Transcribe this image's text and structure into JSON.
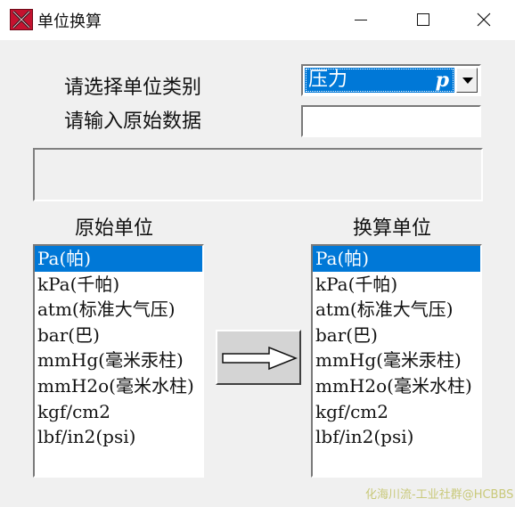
{
  "window": {
    "title": "单位换算",
    "controls": {
      "minimize": "minimize-icon",
      "maximize": "maximize-icon",
      "close": "close-icon"
    }
  },
  "form": {
    "category_label": "请选择单位类别",
    "input_label": "请输入原始数据",
    "category": {
      "text": "压力",
      "symbol": "p"
    },
    "input_value": "",
    "result_text": ""
  },
  "source": {
    "header": "原始单位",
    "items": [
      "Pa(帕)",
      "kPa(千帕)",
      "atm(标准大气压)",
      "bar(巴)",
      "mmHg(毫米汞柱)",
      "mmH2o(毫米水柱)",
      "kgf/cm2",
      "lbf/in2(psi)"
    ],
    "selected_index": 0
  },
  "target": {
    "header": "换算单位",
    "items": [
      "Pa(帕)",
      "kPa(千帕)",
      "atm(标准大气压)",
      "bar(巴)",
      "mmHg(毫米汞柱)",
      "mmH2o(毫米水柱)",
      "kgf/cm2",
      "lbf/in2(psi)"
    ],
    "selected_index": 0
  },
  "convert_button": {
    "icon": "right-arrow-icon"
  },
  "watermark": "化海川流-工业社群@HCBBS",
  "colors": {
    "selection": "#0078d7",
    "background": "#f0f0f0",
    "icon_red": "#c4122f"
  }
}
